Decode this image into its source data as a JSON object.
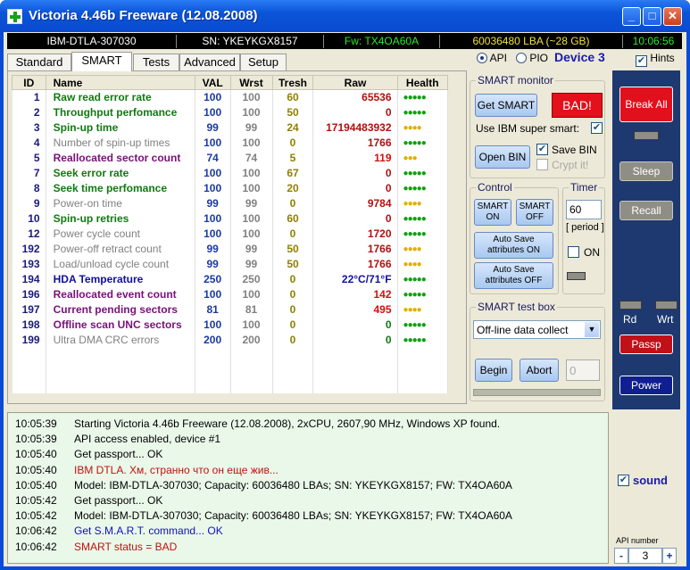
{
  "window": {
    "title": "Victoria 4.46b Freeware (12.08.2008)",
    "min": "_",
    "max": "□",
    "close": "✕"
  },
  "infobar": {
    "model": "IBM-DTLA-307030",
    "serial": "SN: YKEYKGX8157",
    "firmware": "Fw: TX4OA60A",
    "capacity": "60036480 LBA (~28 GB)",
    "clock": "10:06:56"
  },
  "tabs": [
    "Standard",
    "SMART",
    "Tests",
    "Advanced",
    "Setup"
  ],
  "mode": {
    "api": "API",
    "pio": "PIO",
    "device": "Device 3",
    "hints": "Hints"
  },
  "table": {
    "headers": [
      "ID",
      "Name",
      "VAL",
      "Wrst",
      "Tresh",
      "Raw",
      "Health"
    ],
    "rows": [
      {
        "id": "1",
        "name": "Raw read error rate",
        "val": "100",
        "wrst": "100",
        "tresh": "60",
        "raw": "65536",
        "health": "●●●●●",
        "color": "#107a10",
        "rawColor": "#b01010",
        "hcolor": "#10a010"
      },
      {
        "id": "2",
        "name": "Throughput perfomance",
        "val": "100",
        "wrst": "100",
        "tresh": "50",
        "raw": "0",
        "health": "●●●●●",
        "color": "#107a10",
        "rawColor": "#b01010",
        "hcolor": "#10a010"
      },
      {
        "id": "3",
        "name": "Spin-up time",
        "val": "99",
        "wrst": "99",
        "tresh": "24",
        "raw": "17194483932",
        "health": "●●●●",
        "color": "#107a10",
        "rawColor": "#b01010",
        "hcolor": "#e0b000"
      },
      {
        "id": "4",
        "name": "Number of spin-up times",
        "val": "100",
        "wrst": "100",
        "tresh": "0",
        "raw": "1766",
        "health": "●●●●●",
        "color": "#808080",
        "rawColor": "#b01010",
        "hcolor": "#10a010"
      },
      {
        "id": "5",
        "name": "Reallocated sector count",
        "val": "74",
        "wrst": "74",
        "tresh": "5",
        "raw": "119",
        "health": "●●●",
        "color": "#7a107a",
        "rawColor": "#d01010",
        "hcolor": "#e0b000"
      },
      {
        "id": "7",
        "name": "Seek error rate",
        "val": "100",
        "wrst": "100",
        "tresh": "67",
        "raw": "0",
        "health": "●●●●●",
        "color": "#107a10",
        "rawColor": "#b01010",
        "hcolor": "#10a010"
      },
      {
        "id": "8",
        "name": "Seek time perfomance",
        "val": "100",
        "wrst": "100",
        "tresh": "20",
        "raw": "0",
        "health": "●●●●●",
        "color": "#107a10",
        "rawColor": "#b01010",
        "hcolor": "#10a010"
      },
      {
        "id": "9",
        "name": "Power-on time",
        "val": "99",
        "wrst": "99",
        "tresh": "0",
        "raw": "9784",
        "health": "●●●●",
        "color": "#808080",
        "rawColor": "#b01010",
        "hcolor": "#e0b000"
      },
      {
        "id": "10",
        "name": "Spin-up retries",
        "val": "100",
        "wrst": "100",
        "tresh": "60",
        "raw": "0",
        "health": "●●●●●",
        "color": "#107a10",
        "rawColor": "#b01010",
        "hcolor": "#10a010"
      },
      {
        "id": "12",
        "name": "Power cycle count",
        "val": "100",
        "wrst": "100",
        "tresh": "0",
        "raw": "1720",
        "health": "●●●●●",
        "color": "#808080",
        "rawColor": "#b01010",
        "hcolor": "#10a010"
      },
      {
        "id": "192",
        "name": "Power-off retract count",
        "val": "99",
        "wrst": "99",
        "tresh": "50",
        "raw": "1766",
        "health": "●●●●",
        "color": "#808080",
        "rawColor": "#b01010",
        "hcolor": "#e0b000"
      },
      {
        "id": "193",
        "name": "Load/unload cycle count",
        "val": "99",
        "wrst": "99",
        "tresh": "50",
        "raw": "1766",
        "health": "●●●●",
        "color": "#808080",
        "rawColor": "#b01010",
        "hcolor": "#e0b000"
      },
      {
        "id": "194",
        "name": "HDA Temperature",
        "val": "250",
        "wrst": "250",
        "tresh": "0",
        "raw": "22°C/71°F",
        "health": "●●●●●",
        "color": "#1010a0",
        "rawColor": "#1010a0",
        "hcolor": "#10a010"
      },
      {
        "id": "196",
        "name": "Reallocated event count",
        "val": "100",
        "wrst": "100",
        "tresh": "0",
        "raw": "142",
        "health": "●●●●●",
        "color": "#7a107a",
        "rawColor": "#d01010",
        "hcolor": "#10a010"
      },
      {
        "id": "197",
        "name": "Current pending sectors",
        "val": "81",
        "wrst": "81",
        "tresh": "0",
        "raw": "495",
        "health": "●●●●",
        "color": "#7a107a",
        "rawColor": "#d01010",
        "hcolor": "#e0b000"
      },
      {
        "id": "198",
        "name": "Offline scan UNC sectors",
        "val": "100",
        "wrst": "100",
        "tresh": "0",
        "raw": "0",
        "health": "●●●●●",
        "color": "#7a107a",
        "rawColor": "#107a10",
        "hcolor": "#10a010"
      },
      {
        "id": "199",
        "name": "Ultra DMA CRC errors",
        "val": "200",
        "wrst": "200",
        "tresh": "0",
        "raw": "0",
        "health": "●●●●●",
        "color": "#808080",
        "rawColor": "#107a10",
        "hcolor": "#10a010"
      }
    ]
  },
  "smart_monitor": {
    "caption": "SMART monitor",
    "get_smart": "Get SMART",
    "status": "BAD!",
    "use_ibm": "Use IBM super smart:",
    "save_bin": "Save BIN",
    "open_bin": "Open BIN",
    "crypt": "Crypt it!"
  },
  "control": {
    "caption": "Control",
    "smart_on": "SMART ON",
    "smart_off": "SMART OFF",
    "autosave_on": "Auto Save attributes ON",
    "autosave_off": "Auto Save attributes OFF"
  },
  "timer": {
    "caption": "Timer",
    "value": "60",
    "period": "[ period ]",
    "on": "ON"
  },
  "test_box": {
    "caption": "SMART test box",
    "selected": "Off-line data collect",
    "begin": "Begin",
    "abort": "Abort",
    "value": "0"
  },
  "right": {
    "break_all": "Break All",
    "sleep": "Sleep",
    "recall": "Recall",
    "rd": "Rd",
    "wrt": "Wrt",
    "passp": "Passp",
    "power": "Power",
    "sound": "sound",
    "api_number": "API number",
    "minus": "-",
    "plus": "+",
    "api_value": "3"
  },
  "log": [
    {
      "time": "10:05:39",
      "text": "Starting Victoria 4.46b Freeware (12.08.2008), 2xCPU, 2607,90 MHz, Windows XP found.",
      "color": "#000000"
    },
    {
      "time": "10:05:39",
      "text": "API access enabled, device #1",
      "color": "#000000"
    },
    {
      "time": "10:05:40",
      "text": "Get passport... OK",
      "color": "#000000"
    },
    {
      "time": "10:05:40",
      "text": "IBM DTLA. Хм, странно что он еще жив...",
      "color": "#c01010"
    },
    {
      "time": "10:05:40",
      "text": "Model: IBM-DTLA-307030; Capacity: 60036480 LBAs; SN: YKEYKGX8157; FW: TX4OA60A",
      "color": "#000000"
    },
    {
      "time": "10:05:42",
      "text": "Get passport... OK",
      "color": "#000000"
    },
    {
      "time": "10:05:42",
      "text": "Model: IBM-DTLA-307030; Capacity: 60036480 LBAs; SN: YKEYKGX8157; FW: TX4OA60A",
      "color": "#000000"
    },
    {
      "time": "10:06:42",
      "text": "Get S.M.A.R.T. command... OK",
      "color": "#1010c0"
    },
    {
      "time": "10:06:42",
      "text": "SMART status = BAD",
      "color": "#c01010"
    }
  ]
}
